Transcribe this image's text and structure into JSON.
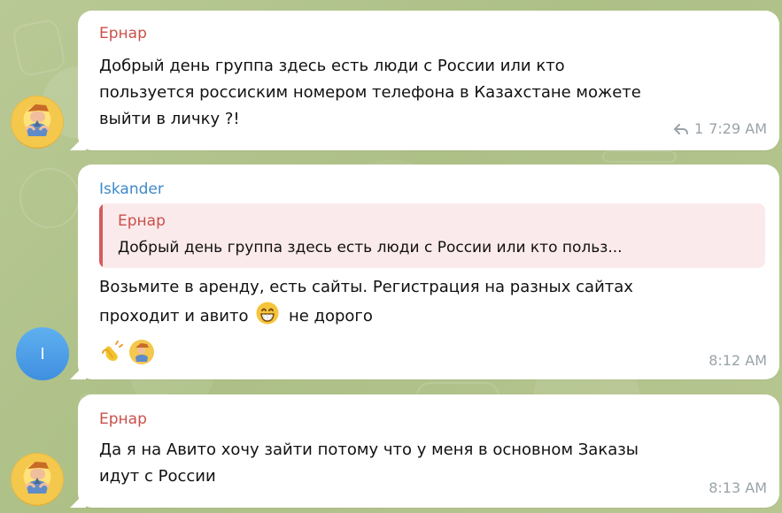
{
  "messages": [
    {
      "sender": "Ернар",
      "text": "Добрый день группа здесь есть люди с России или кто\nпользуется россиским номером телефона в Казахстане можете\nвыйти в личку ?!",
      "reply_count": "1",
      "time": "7:29 AM"
    },
    {
      "sender": "Iskander",
      "avatar_letter": "I",
      "reply_to": {
        "sender": "Ернар",
        "text": "Добрый день группа здесь есть люди с России или кто польз..."
      },
      "text_line_1": "Возьмите в аренду, есть сайты. Регистрация на разных сайтах",
      "text_line_2_before": "проходит и авито",
      "text_line_2_after": " не дорого",
      "time": "8:12 AM",
      "reactions": [
        "clapping-hands",
        "user-avatar"
      ]
    },
    {
      "sender": "Ернар",
      "text": "Да я на Авито хочу зайти потому что у меня в основном Заказы\nидут с России",
      "time": "8:13 AM"
    }
  ],
  "colors": {
    "chat_background": "#b5c58e",
    "bubble": "#ffffff",
    "sender_red": "#c9504a",
    "sender_blue": "#3d89c9",
    "meta": "#9aa3a8"
  },
  "icons": {
    "reply": "reply-icon",
    "grinning_face": "grinning-face-icon",
    "clapping_hands": "clapping-hands-icon"
  }
}
